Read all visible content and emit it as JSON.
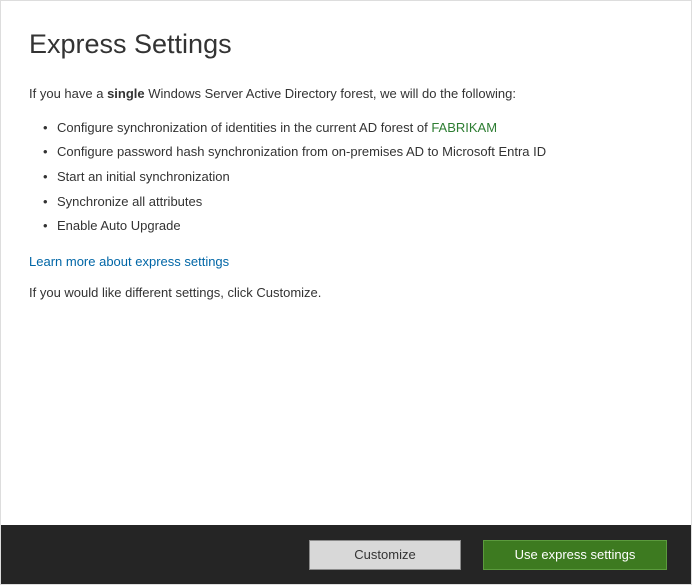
{
  "page": {
    "title": "Express Settings",
    "intro_prefix": "If you have a ",
    "intro_bold": "single",
    "intro_suffix": " Windows Server Active Directory forest, we will do the following:",
    "bullets": {
      "item0_prefix": "Configure synchronization of identities in the current AD forest of ",
      "item0_forest": "FABRIKAM",
      "item1": "Configure password hash synchronization from on-premises AD to Microsoft Entra ID",
      "item2": "Start an initial synchronization",
      "item3": "Synchronize all attributes",
      "item4": "Enable Auto Upgrade"
    },
    "learn_more_label": "Learn more about express settings",
    "customize_note": "If you would like different settings, click Customize."
  },
  "footer": {
    "customize_label": "Customize",
    "express_label": "Use express settings"
  }
}
